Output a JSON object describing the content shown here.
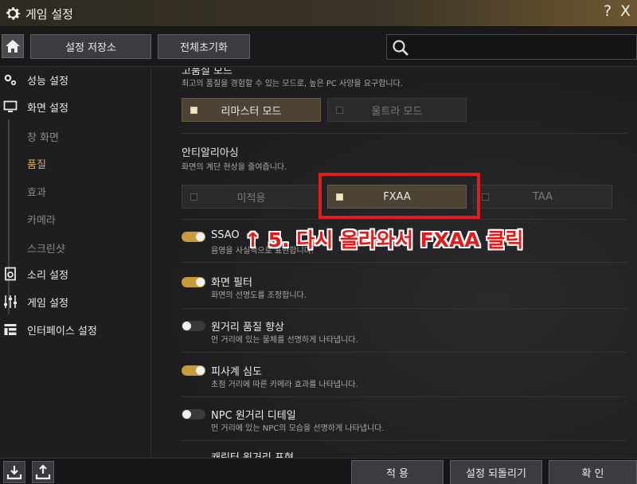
{
  "window": {
    "title": "게임 설정",
    "help_label": "?",
    "close_label": "X"
  },
  "toolbar": {
    "save_label": "설정 저장소",
    "reset_label": "전체초기화",
    "search_placeholder": ""
  },
  "sidebar": {
    "items": [
      {
        "label": "성능 설정",
        "icon": "gears-icon"
      },
      {
        "label": "화면 설정",
        "icon": "monitor-icon"
      },
      {
        "label": "소리 설정",
        "icon": "speaker-icon"
      },
      {
        "label": "게임 설정",
        "icon": "sliders-icon"
      },
      {
        "label": "인터페이스 설정",
        "icon": "layout-icon"
      }
    ],
    "subitems": [
      {
        "label": "창 화면",
        "active": false
      },
      {
        "label": "품질",
        "active": true
      },
      {
        "label": "효과",
        "active": false
      },
      {
        "label": "카메라",
        "active": false
      },
      {
        "label": "스크린샷",
        "active": false
      }
    ]
  },
  "content": {
    "partial_heading": "고품질 모드",
    "quality_desc": "최고의 품질을 경험할 수 있는 모드로, 높은 PC 사양을 요구합니다.",
    "quality_options": [
      {
        "label": "리마스터 모드",
        "selected": true
      },
      {
        "label": "울트라 모드",
        "selected": false
      }
    ],
    "aa_heading": "안티알리아싱",
    "aa_desc": "화면의 계단 현상을 줄여줍니다.",
    "aa_options": [
      {
        "label": "미적용",
        "selected": false
      },
      {
        "label": "FXAA",
        "selected": true
      },
      {
        "label": "TAA",
        "selected": false
      }
    ],
    "toggles": [
      {
        "title": "SSAO",
        "desc": "음영을 사실적으로 표현합니다.",
        "on": true
      },
      {
        "title": "화면 필터",
        "desc": "화면의 선명도를 조정합니다.",
        "on": true
      },
      {
        "title": "원거리 품질 향상",
        "desc": "먼 거리에 있는 물체를 선명하게 나타냅니다.",
        "on": false
      },
      {
        "title": "피사계 심도",
        "desc": "초점 거리에 따른 카메라 효과를 나타냅니다.",
        "on": true
      },
      {
        "title": "NPC 원거리 디테일",
        "desc": "먼 거리에 있는 NPC의 모습을 선명하게 나타냅니다.",
        "on": false
      }
    ],
    "partial_next": "캐릭터 원거리 표현"
  },
  "annotation": {
    "text": "↑ 5. 다시 올라와서 FXAA 클릭",
    "color": "#e31a1a"
  },
  "bottom": {
    "confirm_apply": "적 용",
    "revert": "설정 되돌리기",
    "ok": "확 인"
  },
  "colors": {
    "accent": "#c99a3a",
    "active_text": "#d9b15a",
    "selected_bg": "#4d4335"
  }
}
